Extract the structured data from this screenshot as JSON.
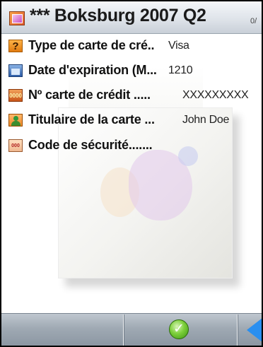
{
  "titlebar": {
    "title": "*** Boksburg 2007 Q2",
    "counter": "0/",
    "icon": "app-icon"
  },
  "fields": [
    {
      "icon": "question-icon",
      "icon_text": "?",
      "label": "Type de carte de cré",
      "dots": "..",
      "value": "Visa"
    },
    {
      "icon": "calendar-icon",
      "icon_text": "",
      "label": "Date d'expiration (M",
      "dots": "...",
      "value": "1210"
    },
    {
      "icon": "number-icon",
      "icon_text": "0000",
      "label": "Nº carte de crédit ",
      "dots": ".....",
      "value": "XXXXXXXXX"
    },
    {
      "icon": "person-icon",
      "icon_text": "",
      "label": "Titulaire de la carte ",
      "dots": "...",
      "value": "John Doe"
    },
    {
      "icon": "security-code-icon",
      "icon_text": "000",
      "label": "Code de sécurité",
      "dots": ".......",
      "value": ""
    }
  ],
  "bottombar": {
    "ok_icon": "checkmark-icon",
    "ok_glyph": "✓",
    "back_icon": "back-arrow-icon"
  }
}
